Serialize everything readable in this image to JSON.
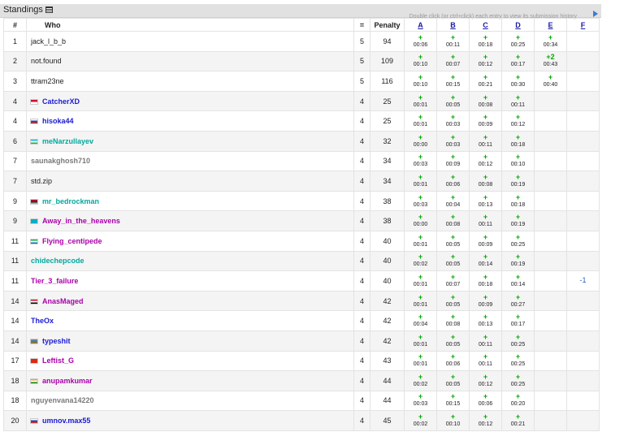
{
  "header": {
    "title": "Standings",
    "hint": "Double click (or ctrl+click) each entry to view its submission history"
  },
  "columns": {
    "rank": "#",
    "who": "Who",
    "solved": "=",
    "penalty": "Penalty",
    "problems": [
      "A",
      "B",
      "C",
      "D",
      "E",
      "F"
    ]
  },
  "flags": {
    "id": [
      "#ffffff",
      "#e8e8e8",
      "#d21034"
    ],
    "ru": [
      "#ffffff",
      "#2a3fb0",
      "#d52b1e"
    ],
    "uz": [
      "#1eb4e6",
      "#ffffff",
      "#1eb53a"
    ],
    "am": [
      "#d90012",
      "#0033a0",
      "#f2a800"
    ],
    "kz": [
      "#00afca",
      "#00afca",
      "#00afca"
    ],
    "sl": [
      "#1eb53a",
      "#ffffff",
      "#0072c6"
    ],
    "eg": [
      "#ce1126",
      "#ffffff",
      "#000000"
    ],
    "az": [
      "#00b5e2",
      "#ef3340",
      "#509e2f"
    ],
    "cn": [
      "#de2910",
      "#de2910",
      "#de2910"
    ],
    "in": [
      "#ff9933",
      "#ffffff",
      "#138808"
    ]
  },
  "rows": [
    {
      "rank": "1",
      "name": "jack_l_b_b",
      "style": "black",
      "flag": "",
      "solved": "5",
      "penalty": "94",
      "cells": [
        [
          "+",
          "00:06"
        ],
        [
          "+",
          "00:11"
        ],
        [
          "+",
          "00:18"
        ],
        [
          "+",
          "00:25"
        ],
        [
          "+",
          "00:34"
        ],
        [
          "",
          ""
        ]
      ]
    },
    {
      "rank": "2",
      "name": "not.found",
      "style": "black",
      "flag": "",
      "solved": "5",
      "penalty": "109",
      "cells": [
        [
          "+",
          "00:10"
        ],
        [
          "+",
          "00:07"
        ],
        [
          "+",
          "00:12"
        ],
        [
          "+",
          "00:17"
        ],
        [
          "+2",
          "00:43"
        ],
        [
          "",
          ""
        ]
      ]
    },
    {
      "rank": "3",
      "name": "ttram23ne",
      "style": "black",
      "flag": "",
      "solved": "5",
      "penalty": "116",
      "cells": [
        [
          "+",
          "00:10"
        ],
        [
          "+",
          "00:15"
        ],
        [
          "+",
          "00:21"
        ],
        [
          "+",
          "00:30"
        ],
        [
          "+",
          "00:40"
        ],
        [
          "",
          ""
        ]
      ]
    },
    {
      "rank": "4",
      "name": "CatcherXD",
      "style": "blue",
      "flag": "id",
      "solved": "4",
      "penalty": "25",
      "cells": [
        [
          "+",
          "00:01"
        ],
        [
          "+",
          "00:05"
        ],
        [
          "+",
          "00:08"
        ],
        [
          "+",
          "00:11"
        ],
        [
          "",
          ""
        ],
        [
          "",
          ""
        ]
      ]
    },
    {
      "rank": "4",
      "name": "hisoka44",
      "style": "blue",
      "flag": "ru",
      "solved": "4",
      "penalty": "25",
      "cells": [
        [
          "+",
          "00:01"
        ],
        [
          "+",
          "00:03"
        ],
        [
          "+",
          "00:09"
        ],
        [
          "+",
          "00:12"
        ],
        [
          "",
          ""
        ],
        [
          "",
          ""
        ]
      ]
    },
    {
      "rank": "6",
      "name": "meNarzullayev",
      "style": "cyan",
      "flag": "uz",
      "solved": "4",
      "penalty": "32",
      "cells": [
        [
          "+",
          "00:00"
        ],
        [
          "+",
          "00:03"
        ],
        [
          "+",
          "00:11"
        ],
        [
          "+",
          "00:18"
        ],
        [
          "",
          ""
        ],
        [
          "",
          ""
        ]
      ]
    },
    {
      "rank": "7",
      "name": "saunakghosh710",
      "style": "grey",
      "flag": "",
      "solved": "4",
      "penalty": "34",
      "cells": [
        [
          "+",
          "00:03"
        ],
        [
          "+",
          "00:09"
        ],
        [
          "+",
          "00:12"
        ],
        [
          "+",
          "00:10"
        ],
        [
          "",
          ""
        ],
        [
          "",
          ""
        ]
      ]
    },
    {
      "rank": "7",
      "name": "std.zip",
      "style": "black",
      "flag": "",
      "solved": "4",
      "penalty": "34",
      "cells": [
        [
          "+",
          "00:01"
        ],
        [
          "+",
          "00:06"
        ],
        [
          "+",
          "00:08"
        ],
        [
          "+",
          "00:19"
        ],
        [
          "",
          ""
        ],
        [
          "",
          ""
        ]
      ]
    },
    {
      "rank": "9",
      "name": "mr_bedrockman",
      "style": "cyan",
      "flag": "am",
      "solved": "4",
      "penalty": "38",
      "cells": [
        [
          "+",
          "00:03"
        ],
        [
          "+",
          "00:04"
        ],
        [
          "+",
          "00:13"
        ],
        [
          "+",
          "00:18"
        ],
        [
          "",
          ""
        ],
        [
          "",
          ""
        ]
      ]
    },
    {
      "rank": "9",
      "name": "Away_in_the_heavens",
      "style": "violet",
      "flag": "kz",
      "solved": "4",
      "penalty": "38",
      "cells": [
        [
          "+",
          "00:00"
        ],
        [
          "+",
          "00:08"
        ],
        [
          "+",
          "00:11"
        ],
        [
          "+",
          "00:19"
        ],
        [
          "",
          ""
        ],
        [
          "",
          ""
        ]
      ]
    },
    {
      "rank": "11",
      "name": "Flying_centipede",
      "style": "violet",
      "flag": "sl",
      "solved": "4",
      "penalty": "40",
      "cells": [
        [
          "+",
          "00:01"
        ],
        [
          "+",
          "00:05"
        ],
        [
          "+",
          "00:09"
        ],
        [
          "+",
          "00:25"
        ],
        [
          "",
          ""
        ],
        [
          "",
          ""
        ]
      ]
    },
    {
      "rank": "11",
      "name": "chidechepcode",
      "style": "cyan",
      "flag": "",
      "solved": "4",
      "penalty": "40",
      "cells": [
        [
          "+",
          "00:02"
        ],
        [
          "+",
          "00:05"
        ],
        [
          "+",
          "00:14"
        ],
        [
          "+",
          "00:19"
        ],
        [
          "",
          ""
        ],
        [
          "",
          ""
        ]
      ]
    },
    {
      "rank": "11",
      "name": "Tier_3_failure",
      "style": "violet",
      "flag": "",
      "solved": "4",
      "penalty": "40",
      "cells": [
        [
          "+",
          "00:01"
        ],
        [
          "+",
          "00:07"
        ],
        [
          "+",
          "00:18"
        ],
        [
          "+",
          "00:14"
        ],
        [
          "",
          ""
        ],
        [
          "-1",
          ""
        ]
      ]
    },
    {
      "rank": "14",
      "name": "AnasMaged",
      "style": "violet",
      "flag": "eg",
      "solved": "4",
      "penalty": "42",
      "cells": [
        [
          "+",
          "00:01"
        ],
        [
          "+",
          "00:05"
        ],
        [
          "+",
          "00:09"
        ],
        [
          "+",
          "00:27"
        ],
        [
          "",
          ""
        ],
        [
          "",
          ""
        ]
      ]
    },
    {
      "rank": "14",
      "name": "TheOx",
      "style": "blue",
      "flag": "",
      "solved": "4",
      "penalty": "42",
      "cells": [
        [
          "+",
          "00:04"
        ],
        [
          "+",
          "00:08"
        ],
        [
          "+",
          "00:13"
        ],
        [
          "+",
          "00:17"
        ],
        [
          "",
          ""
        ],
        [
          "",
          ""
        ]
      ]
    },
    {
      "rank": "14",
      "name": "typeshit",
      "style": "blue",
      "flag": "az",
      "solved": "4",
      "penalty": "42",
      "cells": [
        [
          "+",
          "00:01"
        ],
        [
          "+",
          "00:05"
        ],
        [
          "+",
          "00:11"
        ],
        [
          "+",
          "00:25"
        ],
        [
          "",
          ""
        ],
        [
          "",
          ""
        ]
      ]
    },
    {
      "rank": "17",
      "name": "Leftist_G",
      "style": "violet",
      "flag": "cn",
      "solved": "4",
      "penalty": "43",
      "cells": [
        [
          "+",
          "00:01"
        ],
        [
          "+",
          "00:06"
        ],
        [
          "+",
          "00:11"
        ],
        [
          "+",
          "00:25"
        ],
        [
          "",
          ""
        ],
        [
          "",
          ""
        ]
      ]
    },
    {
      "rank": "18",
      "name": "anupamkumar",
      "style": "violet",
      "flag": "in",
      "solved": "4",
      "penalty": "44",
      "cells": [
        [
          "+",
          "00:02"
        ],
        [
          "+",
          "00:05"
        ],
        [
          "+",
          "00:12"
        ],
        [
          "+",
          "00:25"
        ],
        [
          "",
          ""
        ],
        [
          "",
          ""
        ]
      ]
    },
    {
      "rank": "18",
      "name": "nguyenvana14220",
      "style": "grey",
      "flag": "",
      "solved": "4",
      "penalty": "44",
      "cells": [
        [
          "+",
          "00:03"
        ],
        [
          "+",
          "00:15"
        ],
        [
          "+",
          "00:06"
        ],
        [
          "+",
          "00:20"
        ],
        [
          "",
          ""
        ],
        [
          "",
          ""
        ]
      ]
    },
    {
      "rank": "20",
      "name": "umnov.max55",
      "style": "blue",
      "flag": "ru",
      "solved": "4",
      "penalty": "45",
      "cells": [
        [
          "+",
          "00:02"
        ],
        [
          "+",
          "00:10"
        ],
        [
          "+",
          "00:12"
        ],
        [
          "+",
          "00:21"
        ],
        [
          "",
          ""
        ],
        [
          "",
          ""
        ]
      ]
    }
  ]
}
